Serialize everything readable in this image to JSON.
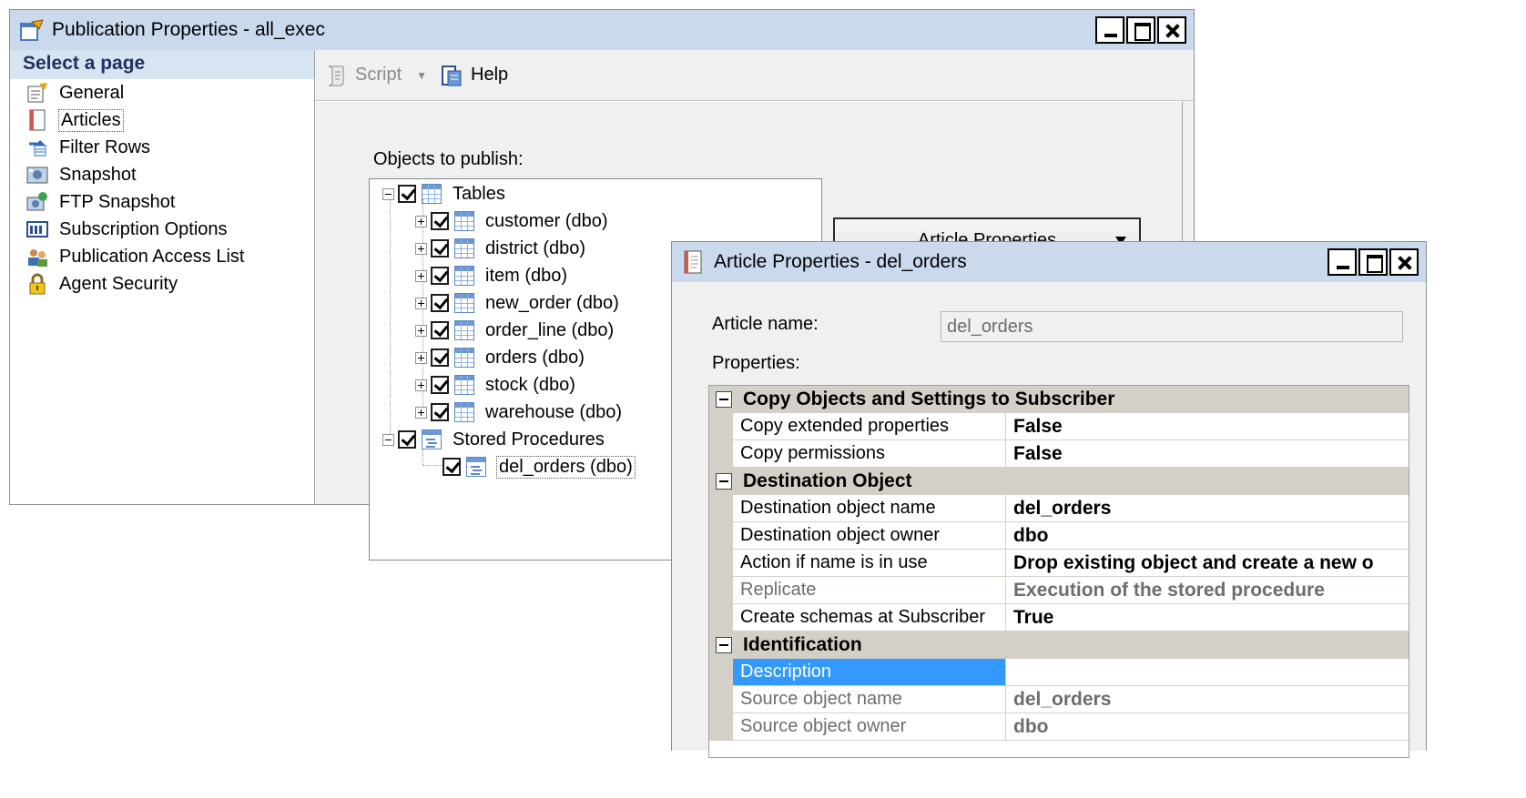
{
  "publication_window": {
    "title": "Publication Properties - all_exec",
    "select_page_header": "Select a page",
    "pages": [
      {
        "label": "General",
        "icon": "properties-icon"
      },
      {
        "label": "Articles",
        "icon": "articles-icon"
      },
      {
        "label": "Filter Rows",
        "icon": "filter-icon"
      },
      {
        "label": "Snapshot",
        "icon": "snapshot-icon"
      },
      {
        "label": "FTP Snapshot",
        "icon": "ftp-snapshot-icon"
      },
      {
        "label": "Subscription Options",
        "icon": "subscription-icon"
      },
      {
        "label": "Publication Access List",
        "icon": "users-icon"
      },
      {
        "label": "Agent Security",
        "icon": "lock-icon"
      }
    ],
    "selected_page": "Articles",
    "toolbar": {
      "script_label": "Script",
      "help_label": "Help"
    },
    "objects_label": "Objects to publish:",
    "tree": {
      "tables_label": "Tables",
      "tables": [
        "customer (dbo)",
        "district (dbo)",
        "item (dbo)",
        "new_order (dbo)",
        "order_line (dbo)",
        "orders (dbo)",
        "stock (dbo)",
        "warehouse (dbo)"
      ],
      "procedures_label": "Stored Procedures",
      "procedures": [
        "del_orders (dbo)"
      ]
    },
    "article_properties_button": "Article Properties"
  },
  "article_window": {
    "title": "Article Properties - del_orders",
    "article_name_label": "Article name:",
    "article_name_value": "del_orders",
    "properties_label": "Properties:",
    "sections": [
      {
        "title": "Copy Objects and Settings to Subscriber",
        "rows": [
          {
            "name": "Copy extended properties",
            "value": "False"
          },
          {
            "name": "Copy permissions",
            "value": "False"
          }
        ]
      },
      {
        "title": "Destination Object",
        "rows": [
          {
            "name": "Destination object name",
            "value": "del_orders"
          },
          {
            "name": "Destination object owner",
            "value": "dbo"
          },
          {
            "name": "Action if name is in use",
            "value": "Drop existing object and create a new o"
          },
          {
            "name": "Replicate",
            "value": "Execution of the stored procedure",
            "readonly": true
          },
          {
            "name": "Create schemas at Subscriber",
            "value": "True"
          }
        ]
      },
      {
        "title": "Identification",
        "rows": [
          {
            "name": "Description",
            "value": "",
            "highlighted": true
          },
          {
            "name": "Source object name",
            "value": "del_orders",
            "readonly": true
          },
          {
            "name": "Source object owner",
            "value": "dbo",
            "readonly": true
          }
        ]
      }
    ]
  },
  "colors": {
    "titlebar": "#cad9eb",
    "selected_row": "#3399ff",
    "category_header": "#d4d0c8"
  }
}
